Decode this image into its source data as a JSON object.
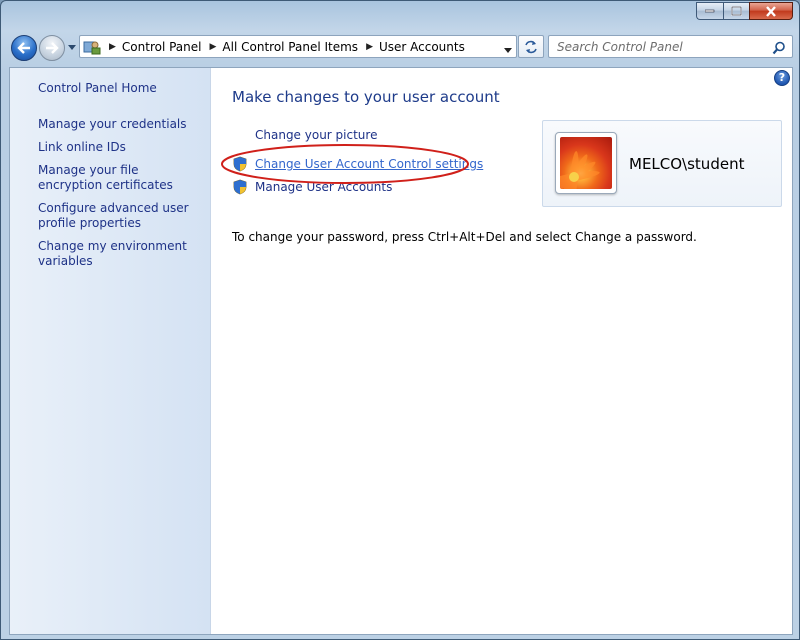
{
  "window": {
    "minimize_icon": "minimize-icon",
    "maximize_icon": "maximize-icon",
    "close_icon": "close-icon"
  },
  "navigation": {
    "back_icon": "back-arrow-icon",
    "forward_icon": "forward-arrow-icon",
    "recent_pages_icon": "chevron-down-icon"
  },
  "address": {
    "location_icon": "control-panel-icon",
    "breadcrumbs": [
      "Control Panel",
      "All Control Panel Items",
      "User Accounts"
    ],
    "refresh_icon": "refresh-icon"
  },
  "search": {
    "placeholder": "Search Control Panel",
    "icon": "search-icon"
  },
  "sidebar": {
    "items": [
      {
        "label": "Control Panel Home"
      },
      {
        "label": "Manage your credentials"
      },
      {
        "label": "Link online IDs"
      },
      {
        "label": "Manage your file encryption certificates"
      },
      {
        "label": "Configure advanced user profile properties"
      },
      {
        "label": "Change my environment variables"
      }
    ]
  },
  "main": {
    "title": "Make changes to your user account",
    "help_label": "?",
    "tasks": [
      {
        "label": "Change your picture",
        "shield": false
      },
      {
        "label": "Change User Account Control settings",
        "shield": true,
        "highlighted": true
      },
      {
        "label": "Manage User Accounts",
        "shield": true
      }
    ],
    "account": {
      "name": "MELCO\\student",
      "avatar_icon": "flower-picture-icon"
    },
    "info": "To change your password, press Ctrl+Alt+Del and select Change a password."
  },
  "colors": {
    "link": "#1e3287",
    "title": "#1e3b8a",
    "annotation": "#d0201a",
    "sidebar_bg": "#dfe9f6"
  }
}
